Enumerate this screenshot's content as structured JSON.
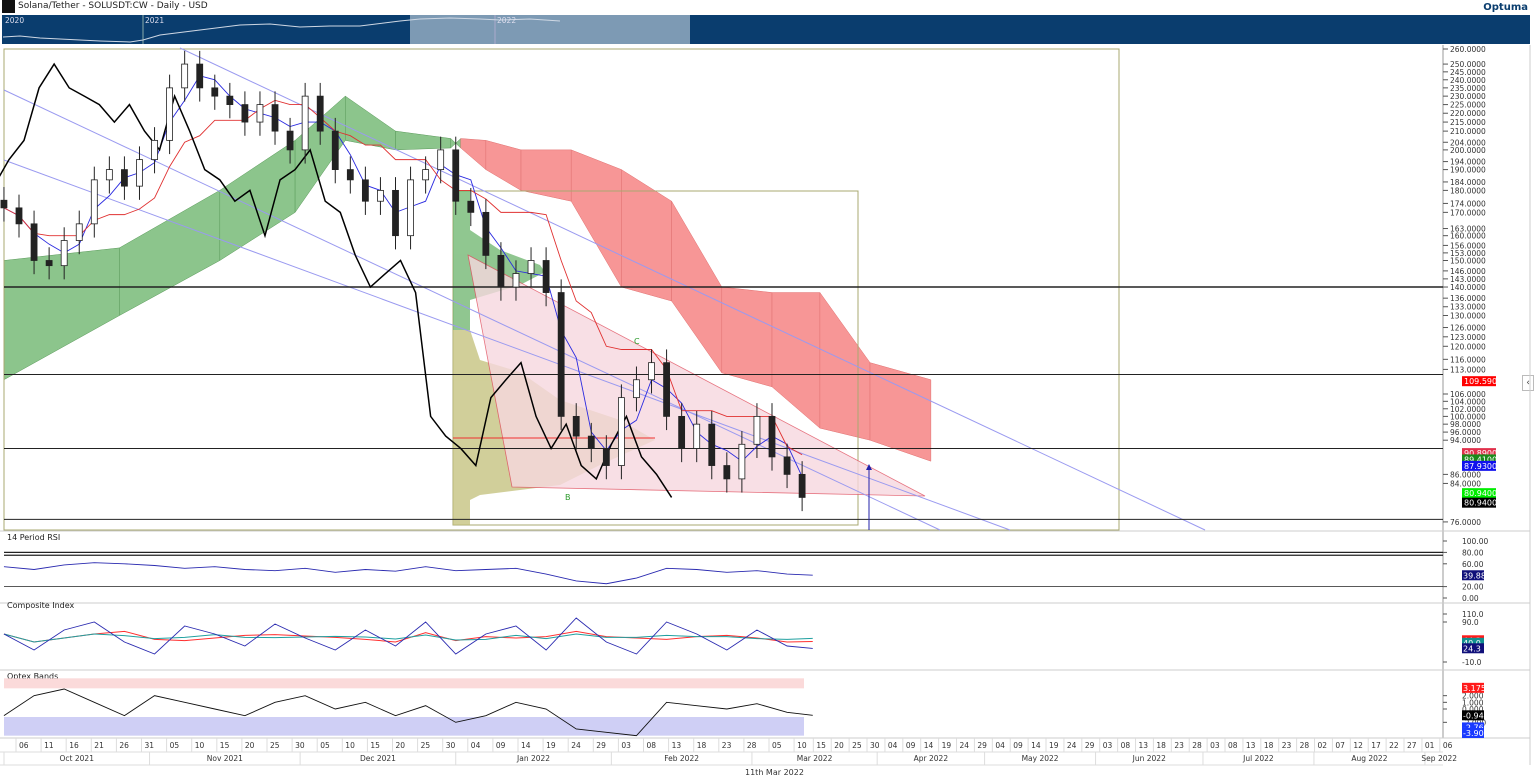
{
  "header": {
    "title": "Solana/Tether - SOLUSDT:CW - Daily - USD",
    "brand": "Optuma",
    "navigator_years": [
      "2020",
      "2021",
      "2022"
    ]
  },
  "footer": {
    "cursor_date": "11th Mar 2022"
  },
  "colors": {
    "nav_bg": "#0a3d6e",
    "nav_sel": "#7d9ab4",
    "cloud_bull": "#8cc58c",
    "cloud_bear": "#f79696",
    "tenkan": "#2a2ae0",
    "kijun": "#e03030",
    "triangle": "#f7d8df"
  },
  "chart_data": {
    "type": "candlestick",
    "title": "Solana/Tether - SOLUSDT:CW - Daily - USD",
    "y_scale": "log",
    "ylim": [
      74,
      262
    ],
    "x_origin": "2021-10-06",
    "step_days": 3,
    "first_day_offset": -3,
    "closes": [
      172,
      165,
      150,
      148,
      158,
      165,
      185,
      190,
      182,
      195,
      205,
      235,
      250,
      235,
      230,
      225,
      215,
      225,
      210,
      200,
      230,
      210,
      190,
      185,
      175,
      180,
      160,
      185,
      190,
      200,
      175,
      170,
      152,
      140,
      145,
      150,
      138,
      100,
      95,
      92,
      88,
      105,
      110,
      115,
      100,
      92,
      98,
      88,
      85,
      93,
      100,
      90,
      86,
      81
    ],
    "cloud": [
      [
        -3,
        150,
        110
      ],
      [
        20,
        155,
        130
      ],
      [
        40,
        180,
        150
      ],
      [
        55,
        205,
        170
      ],
      [
        65,
        230,
        205
      ],
      [
        75,
        210,
        200
      ],
      [
        86,
        206,
        201
      ],
      [
        88,
        201,
        206
      ],
      [
        93,
        190,
        205
      ],
      [
        100,
        180,
        200
      ],
      [
        110,
        175,
        200
      ],
      [
        120,
        140,
        190
      ],
      [
        130,
        135,
        175
      ],
      [
        140,
        112,
        140
      ],
      [
        150,
        108,
        138
      ],
      [
        161,
        97,
        138
      ],
      [
        175,
        94,
        115
      ],
      [
        192,
        89,
        110
      ]
    ],
    "price_axis": [
      "260.0000",
      "250.0000",
      "245.0000",
      "240.0000",
      "235.0000",
      "230.0000",
      "225.0000",
      "220.0000",
      "215.0000",
      "210.0000",
      "204.0000",
      "200.0000",
      "194.0000",
      "190.0000",
      "184.0000",
      "180.0000",
      "174.0000",
      "170.0000",
      "163.0000",
      "160.0000",
      "156.0000",
      "153.0000",
      "150.0000",
      "146.0000",
      "143.0000",
      "140.0000",
      "136.0000",
      "133.0000",
      "130.0000",
      "126.0000",
      "123.0000",
      "120.0000",
      "116.0000",
      "113.0000",
      "106.0000",
      "104.0000",
      "102.0000",
      "100.0000",
      "98.0000",
      "96.0000",
      "94.0000",
      "86.0000",
      "84.0000",
      "76.0000"
    ],
    "price_tags": [
      {
        "v": "109.5900",
        "p": 109.59,
        "c": "#ff0000"
      },
      {
        "v": "90.8900",
        "p": 90.89,
        "c": "#e0304a"
      },
      {
        "v": "89.4100",
        "p": 89.41,
        "c": "#1a8a1a"
      },
      {
        "v": "87.9300",
        "p": 87.93,
        "c": "#1010ee"
      },
      {
        "v": "80.9400",
        "p": 81.9,
        "c": "#00ee00"
      },
      {
        "v": "80.9400",
        "p": 79.9,
        "c": "#000000"
      }
    ],
    "horizontal_levels": [
      140,
      111.5,
      92,
      76.5
    ],
    "annotations": [
      "B",
      "C"
    ],
    "x_ticks": [
      "06",
      "11",
      "16",
      "21",
      "26",
      "31",
      "05",
      "10",
      "15",
      "20",
      "25",
      "30",
      "05",
      "10",
      "15",
      "20",
      "25",
      "30",
      "04",
      "09",
      "14",
      "19",
      "24",
      "29",
      "03",
      "08",
      "13",
      "18",
      "23",
      "28",
      "05",
      "10",
      "15",
      "20",
      "25",
      "30",
      "04",
      "09",
      "14",
      "19",
      "24",
      "29",
      "04",
      "09",
      "14",
      "19",
      "24",
      "29",
      "03",
      "08",
      "13",
      "18",
      "23",
      "28",
      "03",
      "08",
      "13",
      "18",
      "23",
      "28",
      "02",
      "07",
      "12",
      "17",
      "22",
      "27",
      "01",
      "06"
    ],
    "months": [
      {
        "l": "Oct 2021",
        "s": -5,
        "e": 26
      },
      {
        "l": "Nov 2021",
        "s": 26,
        "e": 56
      },
      {
        "l": "Dec 2021",
        "s": 56,
        "e": 87
      },
      {
        "l": "Jan 2022",
        "s": 87,
        "e": 118
      },
      {
        "l": "Feb 2022",
        "s": 118,
        "e": 146
      },
      {
        "l": "Mar 2022",
        "s": 146,
        "e": 177
      },
      {
        "l": "Apr 2022",
        "s": 177,
        "e": 207
      },
      {
        "l": "May 2022",
        "s": 207,
        "e": 238
      },
      {
        "l": "Jun 2022",
        "s": 238,
        "e": 268
      },
      {
        "l": "Jul 2022",
        "s": 268,
        "e": 299
      },
      {
        "l": "Aug 2022",
        "s": 299,
        "e": 330
      },
      {
        "l": "Sep 2022",
        "s": 330,
        "e": 338
      }
    ],
    "panels": [
      {
        "title": "14 Period RSI",
        "ylim": [
          0,
          100
        ],
        "axis": [
          "100.00",
          "80.00",
          "60.00",
          "20.00",
          "0.00"
        ],
        "axis_vals": [
          100,
          80,
          60,
          20,
          0
        ],
        "levels": [
          80,
          75,
          20
        ],
        "series": [
          55,
          50,
          58,
          62,
          60,
          57,
          52,
          55,
          50,
          48,
          52,
          45,
          50,
          47,
          55,
          48,
          50,
          52,
          42,
          30,
          25,
          35,
          52,
          50,
          45,
          48,
          42,
          40
        ],
        "tags": [
          {
            "v": "39.88",
            "p": 39.88,
            "c": "#10107a"
          }
        ]
      },
      {
        "title": "Composite Index",
        "ylim": [
          -15,
          115
        ],
        "axis": [
          "110.0",
          "90.0",
          "-10.0"
        ],
        "axis_vals": [
          110,
          90,
          -10
        ],
        "series": [
          60,
          20,
          70,
          90,
          40,
          10,
          80,
          60,
          30,
          85,
          50,
          20,
          70,
          30,
          90,
          10,
          60,
          80,
          20,
          100,
          40,
          10,
          90,
          60,
          20,
          70,
          30,
          24
        ],
        "tags": [
          {
            "v": "44.3",
            "p": 44.3,
            "c": "#ff1a1a"
          },
          {
            "v": "40.0",
            "p": 38,
            "c": "#119090"
          },
          {
            "v": "24.3",
            "p": 24.3,
            "c": "#10107a"
          }
        ]
      },
      {
        "title": "Optex Bands",
        "ylim": [
          -4.2,
          4.2
        ],
        "axis": [
          "2.000",
          "1.000",
          "0.000",
          "-2.000"
        ],
        "axis_vals": [
          2,
          1,
          0,
          -2
        ],
        "series": [
          -1,
          2,
          3,
          1,
          -1,
          2,
          1,
          0,
          -1,
          1,
          2,
          0,
          1,
          -1,
          0.5,
          -2,
          -1,
          1,
          0,
          -3,
          -3.5,
          -4,
          1,
          0.5,
          0,
          0.8,
          -0.5,
          -0.94
        ],
        "tags": [
          {
            "v": "3.175",
            "p": 3.175,
            "c": "#ff1a1a"
          },
          {
            "v": "-0.943",
            "p": -0.943,
            "c": "#000000"
          },
          {
            "v": "-2.765",
            "p": -2.765,
            "c": "#1a3aff"
          },
          {
            "v": "-3.900",
            "p": -3.6,
            "c": "#1a3aff"
          }
        ]
      }
    ]
  }
}
